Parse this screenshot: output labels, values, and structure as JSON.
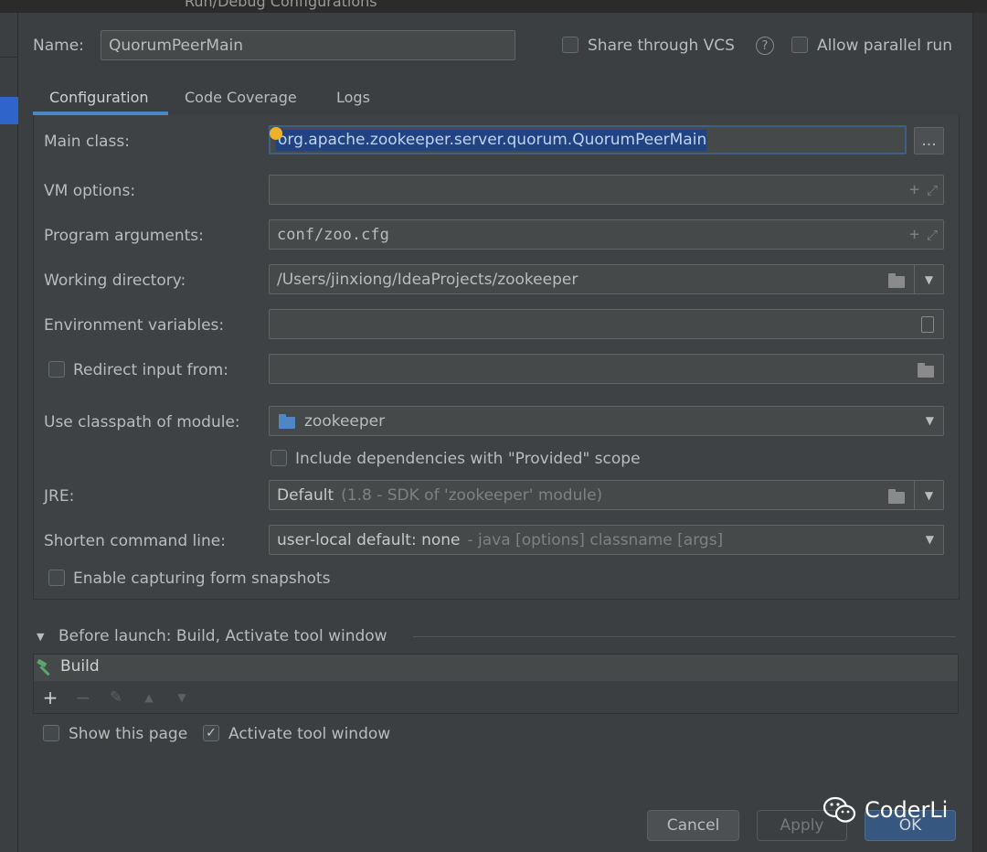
{
  "window": {
    "title": "Run/Debug Configurations"
  },
  "name_row": {
    "label": "Name:",
    "value": "QuorumPeerMain",
    "share_vcs_label": "Share through VCS",
    "share_vcs_checked": false,
    "allow_parallel_label": "Allow parallel run",
    "allow_parallel_checked": false,
    "help_icon": "question-circle-icon"
  },
  "tabs": [
    {
      "label": "Configuration",
      "active": true
    },
    {
      "label": "Code Coverage",
      "active": false
    },
    {
      "label": "Logs",
      "active": false
    }
  ],
  "config": {
    "main_class": {
      "label": "Main class:",
      "value": "org.apache.zookeeper.server.quorum.QuorumPeerMain",
      "browse_label": "..."
    },
    "vm_options": {
      "label": "VM options:",
      "value": ""
    },
    "program_arguments": {
      "label": "Program arguments:",
      "value": "conf/zoo.cfg"
    },
    "working_directory": {
      "label": "Working directory:",
      "value": "/Users/jinxiong/IdeaProjects/zookeeper"
    },
    "environment_variables": {
      "label": "Environment variables:",
      "value": ""
    },
    "redirect_input": {
      "label": "Redirect input from:",
      "checked": false,
      "value": ""
    },
    "classpath_module": {
      "label": "Use classpath of module:",
      "value": "zookeeper"
    },
    "include_provided": {
      "label": "Include dependencies with \"Provided\" scope",
      "checked": false
    },
    "jre": {
      "label": "JRE:",
      "value": "Default",
      "hint": "(1.8 - SDK of 'zookeeper' module)"
    },
    "shorten_command_line": {
      "label": "Shorten command line:",
      "value": "user-local default: none",
      "hint": "- java [options] classname [args]"
    },
    "capture_snapshots": {
      "label": "Enable capturing form snapshots",
      "checked": false
    }
  },
  "before_launch": {
    "header": "Before launch: Build, Activate tool window",
    "items": [
      {
        "label": "Build",
        "icon": "hammer-icon"
      }
    ],
    "toolbar": {
      "add": "+",
      "remove": "−",
      "edit": "✎",
      "up": "▲",
      "down": "▼"
    }
  },
  "bottom_options": {
    "show_page": {
      "label": "Show this page",
      "checked": false
    },
    "activate_tool_window": {
      "label": "Activate tool window",
      "checked": true,
      "mark": "✓"
    }
  },
  "buttons": {
    "cancel": "Cancel",
    "apply": "Apply",
    "ok": "OK"
  },
  "watermark": {
    "text": "CoderLi"
  },
  "colors": {
    "accent": "#4a88c7",
    "selection": "#214283",
    "ok_button": "#365880",
    "build_icon": "#59a869"
  }
}
